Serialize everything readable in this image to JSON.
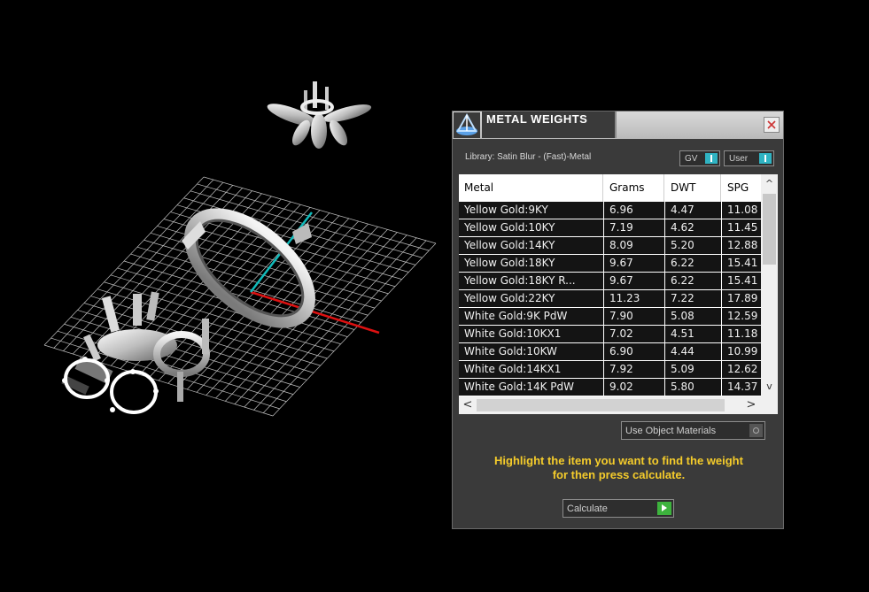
{
  "dialog": {
    "title": "METAL WEIGHTS",
    "close_label": "×",
    "library": "Library: Satin Blur - (Fast)-Metal",
    "toggle_gv": "GV",
    "toggle_user": "User"
  },
  "table": {
    "headers": [
      "Metal",
      "Grams",
      "DWT",
      "SPG"
    ],
    "rows": [
      [
        "Yellow Gold:9KY",
        "6.96",
        "4.47",
        "11.08"
      ],
      [
        "Yellow Gold:10KY",
        "7.19",
        "4.62",
        "11.45"
      ],
      [
        "Yellow Gold:14KY",
        "8.09",
        "5.20",
        "12.88"
      ],
      [
        "Yellow Gold:18KY",
        "9.67",
        "6.22",
        "15.41"
      ],
      [
        "Yellow Gold:18KY R...",
        "9.67",
        "6.22",
        "15.41"
      ],
      [
        "Yellow Gold:22KY",
        "11.23",
        "7.22",
        "17.89"
      ],
      [
        "White Gold:9K PdW",
        "7.90",
        "5.08",
        "12.59"
      ],
      [
        "White Gold:10KX1",
        "7.02",
        "4.51",
        "11.18"
      ],
      [
        "White Gold:10KW",
        "6.90",
        "4.44",
        "10.99"
      ],
      [
        "White Gold:14KX1",
        "7.92",
        "5.09",
        "12.62"
      ],
      [
        "White Gold:14K PdW",
        "9.02",
        "5.80",
        "14.37"
      ]
    ],
    "scroll_up": "^",
    "scroll_down": "v",
    "scroll_left": "<",
    "scroll_right": ">"
  },
  "use_object_materials_label": "Use Object Materials",
  "hint_line1": "Highlight the item you want to find the weight",
  "hint_line2": "for then press calculate.",
  "calculate_label": "Calculate",
  "colors": {
    "accent_cyan": "#2fb3c2",
    "hint_yellow": "#f5cc2b",
    "calc_green": "#3db33d"
  },
  "icons": [
    "app-logo-icon",
    "close-icon",
    "play-icon"
  ]
}
